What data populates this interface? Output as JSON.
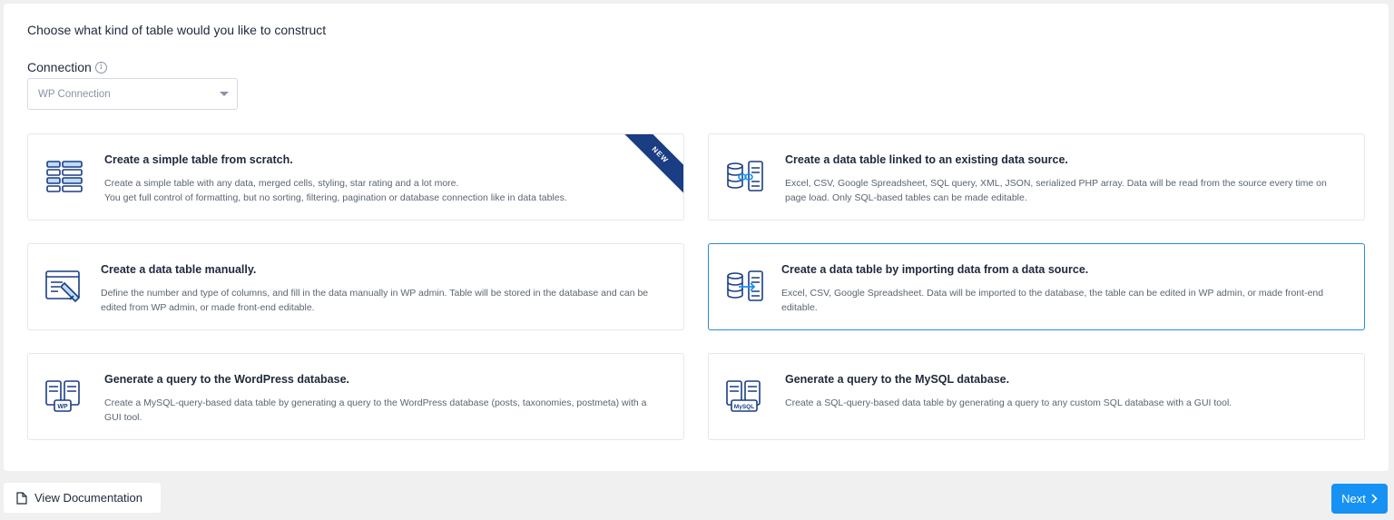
{
  "heading": "Choose what kind of table would you like to construct",
  "connection": {
    "label": "Connection",
    "info_icon": "i",
    "selected": "WP Connection"
  },
  "cards": [
    {
      "title": "Create a simple table from scratch.",
      "description": "Create a simple table with any data, merged cells, styling, star rating and a lot more.\nYou get full control of formatting, but no sorting, filtering, pagination or database connection like in data tables.",
      "badge": "NEW",
      "icon": "simple-table-icon"
    },
    {
      "title": "Create a data table linked to an existing data source.",
      "description": "Excel, CSV, Google Spreadsheet, SQL query, XML, JSON, serialized PHP array. Data will be read from the source every time on page load. Only SQL-based tables can be made editable.",
      "icon": "linked-source-icon"
    },
    {
      "title": "Create a data table manually.",
      "description": "Define the number and type of columns, and fill in the data manually in WP admin. Table will be stored in the database and can be edited from WP admin, or made front-end editable.",
      "icon": "manual-edit-icon"
    },
    {
      "title": "Create a data table by importing data from a data source.",
      "description": "Excel, CSV, Google Spreadsheet. Data will be imported to the database, the table can be edited in WP admin, or made front-end editable.",
      "icon": "import-data-icon"
    },
    {
      "title": "Generate a query to the WordPress database.",
      "description": "Create a MySQL-query-based data table by generating a query to the WordPress database (posts, taxonomies, postmeta) with a GUI tool.",
      "icon_label": "WP",
      "icon": "wp-query-icon"
    },
    {
      "title": "Generate a query to the MySQL database.",
      "description": "Create a SQL-query-based data table by generating a query to any custom SQL database with a GUI tool.",
      "icon_label": "MySQL",
      "icon": "mysql-query-icon"
    }
  ],
  "footer": {
    "doc_label": "View Documentation",
    "next_label": "Next"
  },
  "colors": {
    "navy": "#1a3d83",
    "accent": "#1592f3",
    "selected_border": "#2a8ad8"
  }
}
